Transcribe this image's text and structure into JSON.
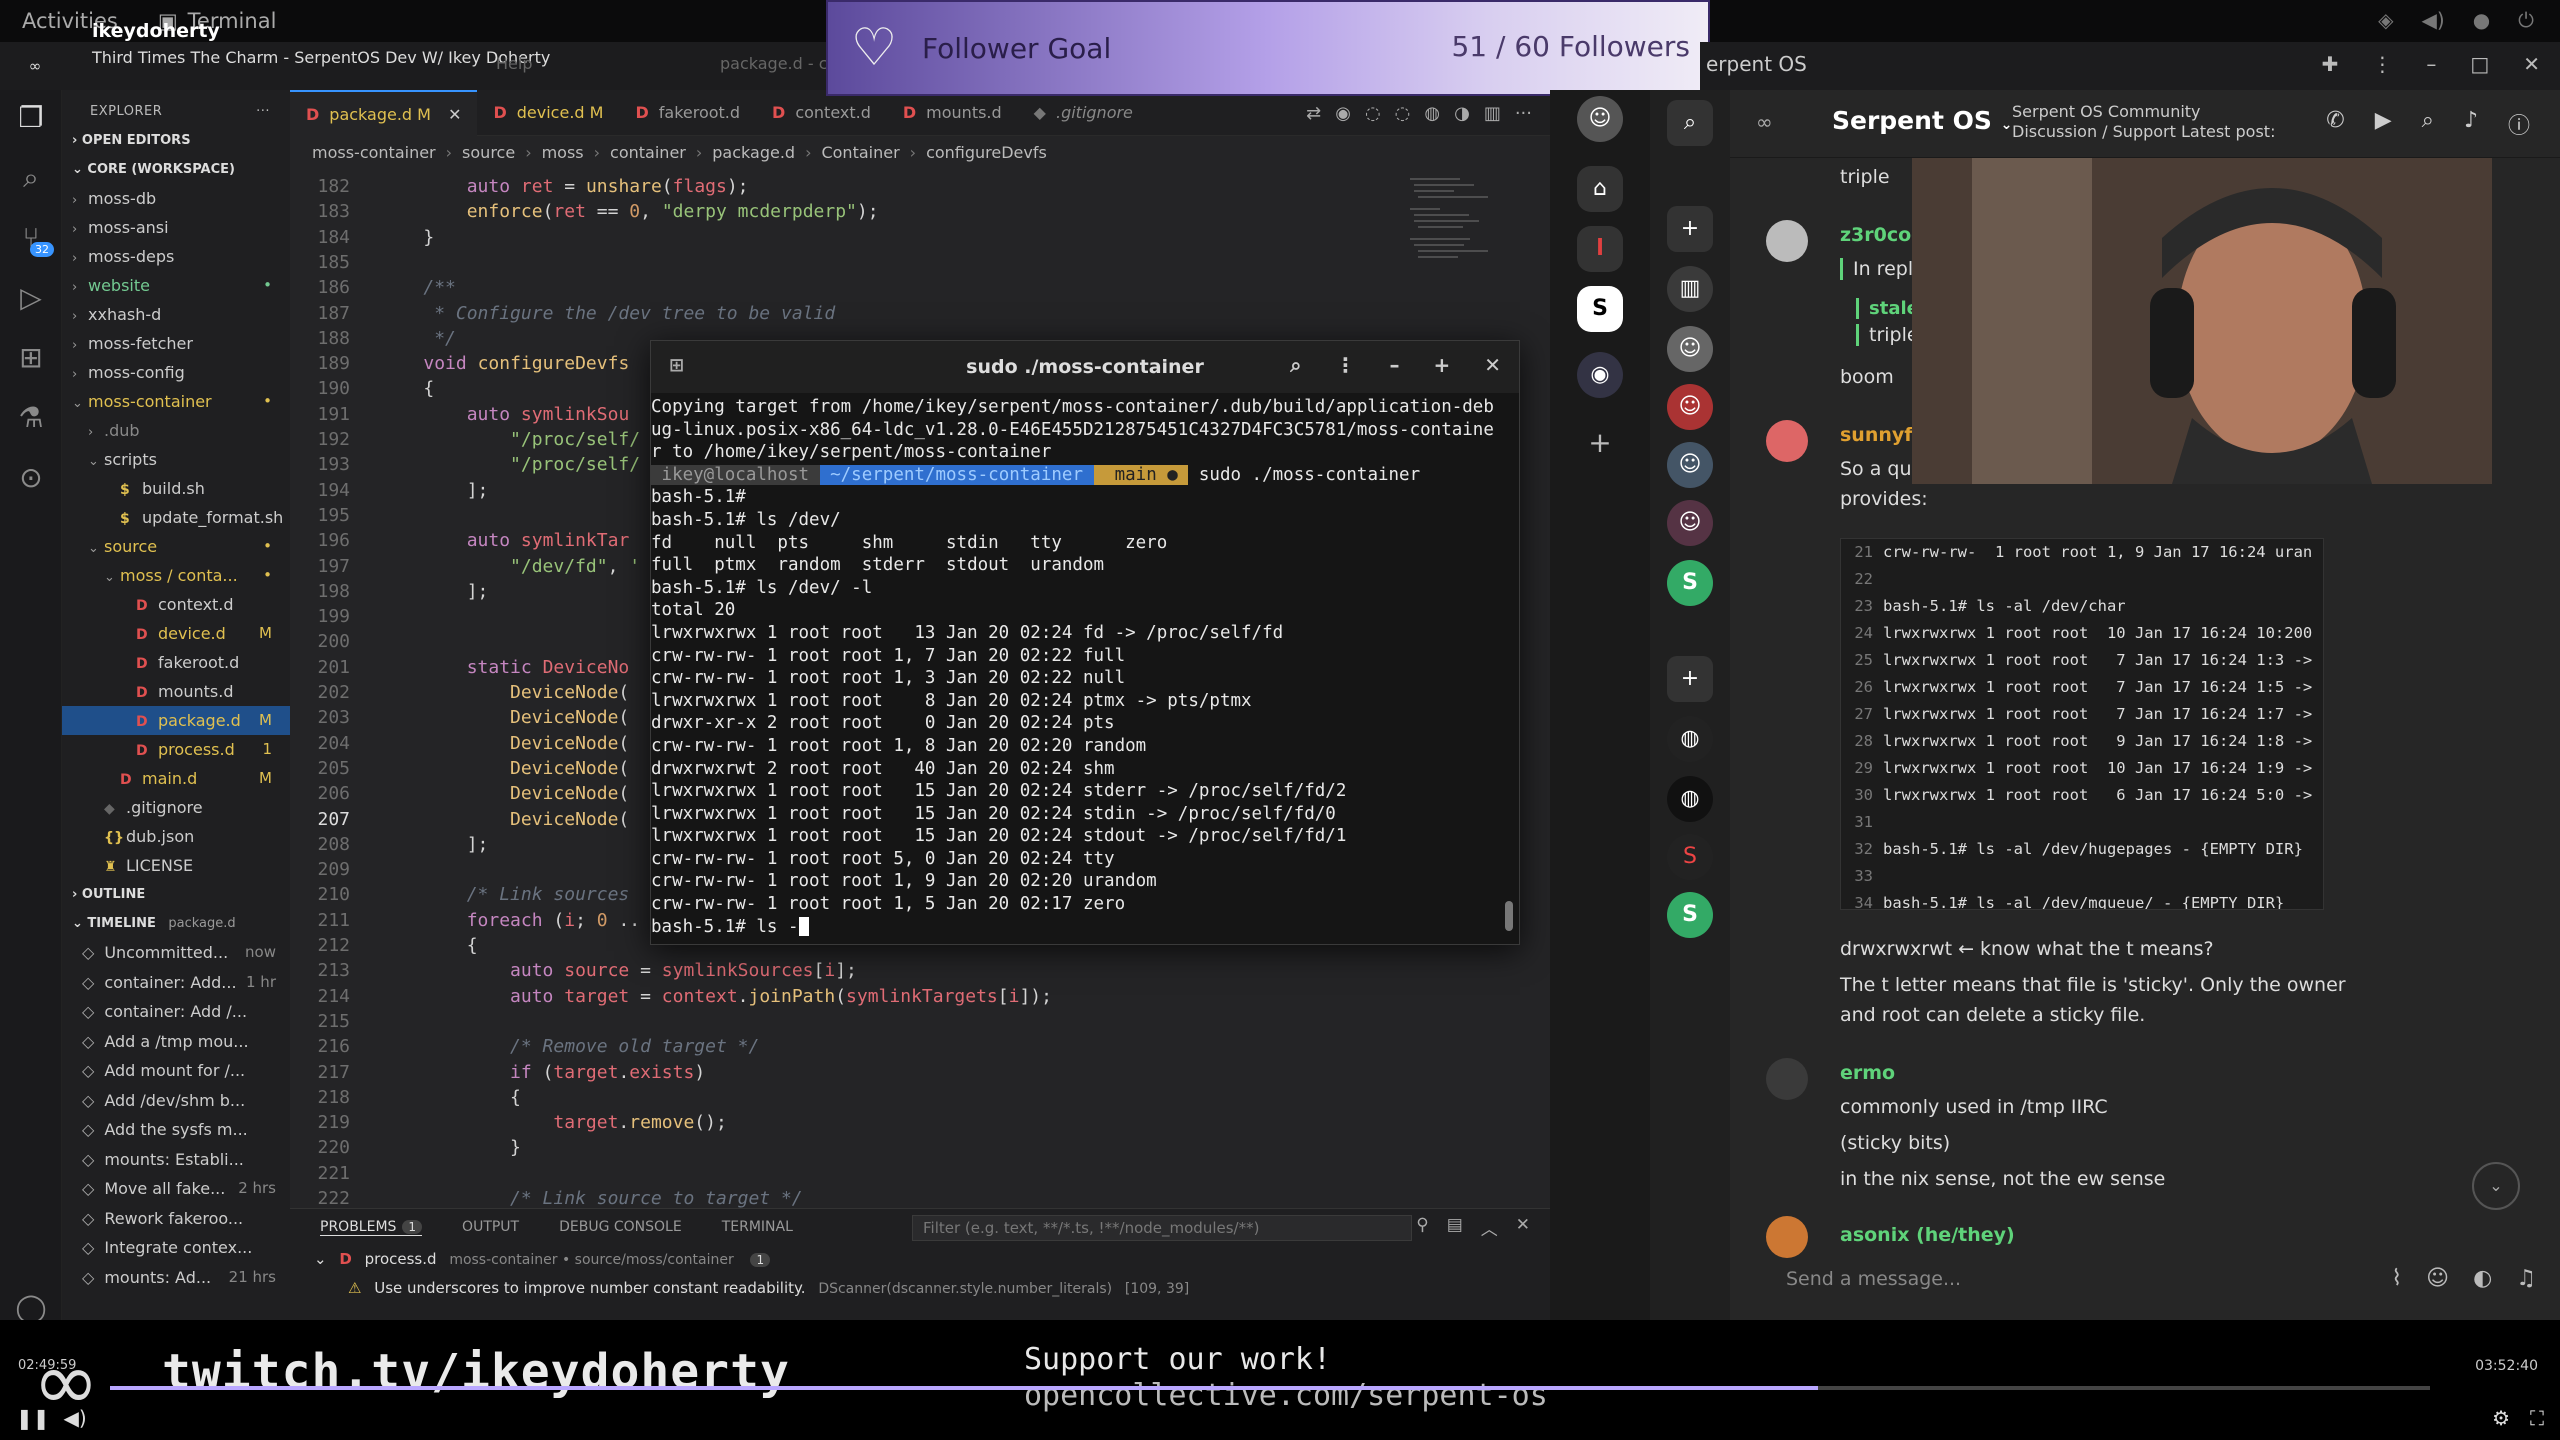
{
  "topbar": {
    "activities": "Activities",
    "terminal": "Terminal"
  },
  "stream": {
    "user": "ikeydoherty",
    "title": "Third Times The Charm - SerpentOS Dev W/ Ikey Doherty"
  },
  "vstitle": {
    "menu": "Help",
    "project": "package.d - c"
  },
  "explorer": {
    "title": "EXPLORER",
    "open_editors": "OPEN EDITORS",
    "workspace": "CORE (WORKSPACE)",
    "items": [
      {
        "label": "moss-db",
        "indent": 0,
        "kind": "folder-closed",
        "status": ""
      },
      {
        "label": "moss-ansi",
        "indent": 0,
        "kind": "folder-closed",
        "status": ""
      },
      {
        "label": "moss-deps",
        "indent": 0,
        "kind": "folder-closed",
        "status": ""
      },
      {
        "label": "website",
        "indent": 0,
        "kind": "folder-closed",
        "status": "•",
        "color": "#73c991"
      },
      {
        "label": "xxhash-d",
        "indent": 0,
        "kind": "folder-closed",
        "status": ""
      },
      {
        "label": "moss-fetcher",
        "indent": 0,
        "kind": "folder-closed",
        "status": ""
      },
      {
        "label": "moss-config",
        "indent": 0,
        "kind": "folder-closed",
        "status": ""
      },
      {
        "label": "moss-container",
        "indent": 0,
        "kind": "folder-open",
        "status": "•",
        "color": "#e0c050"
      },
      {
        "label": ".dub",
        "indent": 1,
        "kind": "folder-closed",
        "status": "",
        "color": "#888"
      },
      {
        "label": "scripts",
        "indent": 1,
        "kind": "folder-open",
        "status": ""
      },
      {
        "label": "build.sh",
        "indent": 2,
        "kind": "sh",
        "status": ""
      },
      {
        "label": "update_format.sh",
        "indent": 2,
        "kind": "sh",
        "status": ""
      },
      {
        "label": "source",
        "indent": 1,
        "kind": "folder-open",
        "status": "•",
        "color": "#e0c050"
      },
      {
        "label": "moss / conta...",
        "indent": 2,
        "kind": "folder-open",
        "status": "•",
        "color": "#e0c050"
      },
      {
        "label": "context.d",
        "indent": 3,
        "kind": "d",
        "status": ""
      },
      {
        "label": "device.d",
        "indent": 3,
        "kind": "d",
        "status": "M",
        "color": "#e0c050"
      },
      {
        "label": "fakeroot.d",
        "indent": 3,
        "kind": "d",
        "status": ""
      },
      {
        "label": "mounts.d",
        "indent": 3,
        "kind": "d",
        "status": ""
      },
      {
        "label": "package.d",
        "indent": 3,
        "kind": "d",
        "status": "M",
        "color": "#e0c050",
        "selected": true
      },
      {
        "label": "process.d",
        "indent": 3,
        "kind": "d",
        "status": "1",
        "color": "#e0c050"
      },
      {
        "label": "main.d",
        "indent": 2,
        "kind": "d",
        "status": "M",
        "color": "#e0c050"
      },
      {
        "label": ".gitignore",
        "indent": 1,
        "kind": "git",
        "status": ""
      },
      {
        "label": "dub.json",
        "indent": 1,
        "kind": "json",
        "status": ""
      },
      {
        "label": "LICENSE",
        "indent": 1,
        "kind": "lic",
        "status": ""
      }
    ],
    "outline": "OUTLINE",
    "timeline": "TIMELINE",
    "timeline_file": "package.d",
    "timeline_items": [
      {
        "label": "Uncommitted...",
        "time": "now"
      },
      {
        "label": "container: Add...",
        "time": "1 hr"
      },
      {
        "label": "container: Add /...",
        "time": ""
      },
      {
        "label": "Add a /tmp mou...",
        "time": ""
      },
      {
        "label": "Add mount for /...",
        "time": ""
      },
      {
        "label": "Add /dev/shm b...",
        "time": ""
      },
      {
        "label": "Add the sysfs m...",
        "time": ""
      },
      {
        "label": "mounts: Establi...",
        "time": ""
      },
      {
        "label": "Move all fake...",
        "time": "2 hrs"
      },
      {
        "label": "Rework fakeroo...",
        "time": ""
      },
      {
        "label": "Integrate contex...",
        "time": ""
      },
      {
        "label": "mounts: Ad...",
        "time": "21 hrs"
      }
    ]
  },
  "tabs": [
    {
      "label": "package.d",
      "mod": "M",
      "active": true
    },
    {
      "label": "device.d",
      "mod": "M",
      "active": false
    },
    {
      "label": "fakeroot.d",
      "mod": "",
      "active": false
    },
    {
      "label": "context.d",
      "mod": "",
      "active": false
    },
    {
      "label": "mounts.d",
      "mod": "",
      "active": false
    },
    {
      "label": ".gitignore",
      "mod": "",
      "active": false,
      "git": true
    }
  ],
  "breadcrumbs": [
    "moss-container",
    "source",
    "moss",
    "container",
    "package.d",
    "Container",
    "configureDevfs"
  ],
  "code": {
    "current_line": 207,
    "lines": [
      {
        "n": 182,
        "html": "        <span class='kw'>auto</span> <span class='vr'>ret</span> = <span class='fn'>unshare</span>(<span class='vr'>flags</span>);"
      },
      {
        "n": 183,
        "html": "        <span class='fn'>enforce</span>(<span class='vr'>ret</span> == <span class='nm'>0</span>, <span class='st2'>\"derpy mcderpderp\"</span>);"
      },
      {
        "n": 184,
        "html": "    }"
      },
      {
        "n": 185,
        "html": ""
      },
      {
        "n": 186,
        "html": "    <span class='cm'>/**</span>"
      },
      {
        "n": 187,
        "html": "    <span class='cm'> * Configure the /dev tree to be valid</span>"
      },
      {
        "n": 188,
        "html": "    <span class='cm'> */</span>"
      },
      {
        "n": 189,
        "html": "    <span class='kw'>void</span> <span class='fn'>configureDevfs</span>"
      },
      {
        "n": 190,
        "html": "    {"
      },
      {
        "n": 191,
        "html": "        <span class='kw'>auto</span> <span class='vr'>symlinkSou</span>"
      },
      {
        "n": 192,
        "html": "            <span class='st2'>\"/proc/self/</span>"
      },
      {
        "n": 193,
        "html": "            <span class='st2'>\"/proc/self/</span>"
      },
      {
        "n": 194,
        "html": "        ];"
      },
      {
        "n": 195,
        "html": ""
      },
      {
        "n": 196,
        "html": "        <span class='kw'>auto</span> <span class='vr'>symlinkTar</span>"
      },
      {
        "n": 197,
        "html": "            <span class='st2'>\"/dev/fd\"</span>, <span class='st2'>'</span>"
      },
      {
        "n": 198,
        "html": "        ];"
      },
      {
        "n": 199,
        "html": ""
      },
      {
        "n": 200,
        "html": ""
      },
      {
        "n": 201,
        "html": "        <span class='kw'>static</span> <span class='ty'>DeviceNo</span>"
      },
      {
        "n": 202,
        "html": "            <span class='fn'>DeviceNode</span>("
      },
      {
        "n": 203,
        "html": "            <span class='fn'>DeviceNode</span>("
      },
      {
        "n": 204,
        "html": "            <span class='fn'>DeviceNode</span>("
      },
      {
        "n": 205,
        "html": "            <span class='fn'>DeviceNode</span>("
      },
      {
        "n": 206,
        "html": "            <span class='fn'>DeviceNode</span>("
      },
      {
        "n": 207,
        "html": "            <span class='fn'>DeviceNode</span>("
      },
      {
        "n": 208,
        "html": "        ];"
      },
      {
        "n": 209,
        "html": ""
      },
      {
        "n": 210,
        "html": "        <span class='cm'>/* Link sources</span>"
      },
      {
        "n": 211,
        "html": "        <span class='kw'>foreach</span> (<span class='vr'>i</span>; <span class='nm'>0</span> .."
      },
      {
        "n": 212,
        "html": "        {"
      },
      {
        "n": 213,
        "html": "            <span class='kw'>auto</span> <span class='vr'>source</span> = <span class='vr'>symlinkSources</span>[<span class='vr'>i</span>];"
      },
      {
        "n": 214,
        "html": "            <span class='kw'>auto</span> <span class='vr'>target</span> = <span class='vr'>context</span>.<span class='fn'>joinPath</span>(<span class='vr'>symlinkTargets</span>[<span class='vr'>i</span>]);"
      },
      {
        "n": 215,
        "html": ""
      },
      {
        "n": 216,
        "html": "            <span class='cm'>/* Remove old target */</span>"
      },
      {
        "n": 217,
        "html": "            <span class='kw'>if</span> (<span class='vr'>target</span>.<span class='vr'>exists</span>)"
      },
      {
        "n": 218,
        "html": "            {"
      },
      {
        "n": 219,
        "html": "                <span class='vr'>target</span>.<span class='fn'>remove</span>();"
      },
      {
        "n": 220,
        "html": "            }"
      },
      {
        "n": 221,
        "html": ""
      },
      {
        "n": 222,
        "html": "            <span class='cm'>/* Link source to target */</span>"
      }
    ]
  },
  "panel": {
    "tabs": [
      "PROBLEMS",
      "OUTPUT",
      "DEBUG CONSOLE",
      "TERMINAL"
    ],
    "problems_count": "1",
    "filter_placeholder": "Filter (e.g. text, **/*.ts, !**/node_modules/**)",
    "file": "process.d",
    "file_path": "moss-container • source/moss/container",
    "file_count": "1",
    "warning": "Use underscores to improve number constant readability.",
    "warning_src": "DScanner(dscanner.style.number_literals)",
    "warning_pos": "[109, 39]"
  },
  "terminal": {
    "title": "sudo ./moss-container",
    "lines": [
      "Copying target from /home/ikey/serpent/moss-container/.dub/build/application-deb",
      "ug-linux.posix-x86_64-ldc_v1.28.0-E46E455D212875451C4327D4FC3C5781/moss-containe",
      "r to /home/ikey/serpent/moss-container"
    ],
    "prompt": {
      "user": " ikey@localhost ",
      "dir": " ~/serpent/moss-container ",
      "branch": "  main ● ",
      "cmd": " sudo ./moss-container"
    },
    "lines2": [
      "bash-5.1#",
      "bash-5.1# ls /dev/",
      "fd    null  pts     shm     stdin   tty      zero",
      "full  ptmx  random  stderr  stdout  urandom",
      "bash-5.1# ls /dev/ -l",
      "total 20",
      "lrwxrwxrwx 1 root root   13 Jan 20 02:24 fd -> /proc/self/fd",
      "crw-rw-rw- 1 root root 1, 7 Jan 20 02:22 full",
      "crw-rw-rw- 1 root root 1, 3 Jan 20 02:22 null",
      "lrwxrwxrwx 1 root root    8 Jan 20 02:24 ptmx -> pts/ptmx",
      "drwxr-xr-x 2 root root    0 Jan 20 02:24 pts",
      "crw-rw-rw- 1 root root 1, 8 Jan 20 02:20 random",
      "drwxrwxrwt 2 root root   40 Jan 20 02:24 shm",
      "lrwxrwxrwx 1 root root   15 Jan 20 02:24 stderr -> /proc/self/fd/2",
      "lrwxrwxrwx 1 root root   15 Jan 20 02:24 stdin -> /proc/self/fd/0",
      "lrwxrwxrwx 1 root root   15 Jan 20 02:24 stdout -> /proc/self/fd/1",
      "crw-rw-rw- 1 root root 5, 0 Jan 20 02:24 tty",
      "crw-rw-rw- 1 root root 1, 9 Jan 20 02:20 urandom",
      "crw-rw-rw- 1 root root 1, 5 Jan 20 02:17 zero"
    ],
    "last": "bash-5.1# ls -"
  },
  "goal": {
    "label": "Follower Goal",
    "count": "51 / 60 Followers",
    "current": 51,
    "target": 60
  },
  "discord": {
    "app_title": "erpent OS",
    "server": "Serpent OS",
    "channel_desc_1": "Serpent OS Community",
    "channel_desc_2": "Discussion / Support Latest post:",
    "messages": {
      "triple1": "triple",
      "u1": "z3r0coo",
      "reply": "In reply",
      "u1b": "staleb",
      "triple2": "triple",
      "boom": "boom",
      "u2": "sunnyflu",
      "soaqui": "So a qui",
      "provides": "provides:",
      "sticky_q": "drwxrwxrwt ← know what the t means?",
      "sticky_a1": "The t letter means that file is 'sticky'. Only the owner",
      "sticky_a2": "and root can delete a sticky file.",
      "u3": "ermo",
      "m3a": "commonly used in /tmp IIRC",
      "m3b": "(sticky bits)",
      "m3c": "in the nix sense, not the ew sense",
      "u4": "asonix (he/they)"
    },
    "codeblock": [
      {
        "n": "21",
        "t": "crw-rw-rw-  1 root root 1, 9 Jan 17 16:24 uran"
      },
      {
        "n": "22",
        "t": ""
      },
      {
        "n": "23",
        "t": "bash-5.1# ls -al /dev/char"
      },
      {
        "n": "24",
        "t": "lrwxrwxrwx 1 root root  10 Jan 17 16:24 10:200"
      },
      {
        "n": "25",
        "t": "lrwxrwxrwx 1 root root   7 Jan 17 16:24 1:3 ->"
      },
      {
        "n": "26",
        "t": "lrwxrwxrwx 1 root root   7 Jan 17 16:24 1:5 ->"
      },
      {
        "n": "27",
        "t": "lrwxrwxrwx 1 root root   7 Jan 17 16:24 1:7 ->"
      },
      {
        "n": "28",
        "t": "lrwxrwxrwx 1 root root   9 Jan 17 16:24 1:8 ->"
      },
      {
        "n": "29",
        "t": "lrwxrwxrwx 1 root root  10 Jan 17 16:24 1:9 ->"
      },
      {
        "n": "30",
        "t": "lrwxrwxrwx 1 root root   6 Jan 17 16:24 5:0 ->"
      },
      {
        "n": "31",
        "t": ""
      },
      {
        "n": "32",
        "t": "bash-5.1# ls -al /dev/hugepages - {EMPTY DIR}"
      },
      {
        "n": "33",
        "t": ""
      },
      {
        "n": "34",
        "t": "bash-5.1# ls -al /dev/mqueue/ - {EMPTY DIR}"
      }
    ],
    "message_placeholder": "Send a message..."
  },
  "overlay": {
    "twitch": "twitch.tv/ikeydoherty",
    "support": "Support our work!",
    "collective": "opencollective.com/serpent-os",
    "time_elapsed": "02:49:59",
    "time_total": "03:52:40",
    "progress": 0.736
  }
}
